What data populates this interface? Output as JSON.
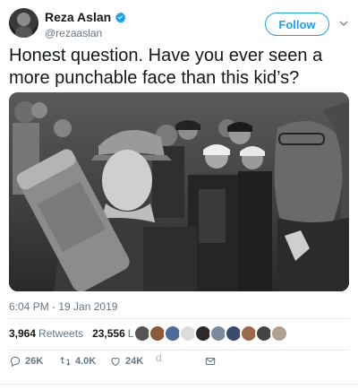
{
  "author": {
    "display_name": "Reza Aslan",
    "handle": "@rezaaslan",
    "avatar_icon": "user-avatar"
  },
  "follow_label": "Follow",
  "tweet": {
    "text": "Honest question. Have you ever seen a more punchable face than this kid’s?",
    "photo_icon": "photo-of-crowd",
    "timestamp": "6:04 PM - 19 Jan 2019"
  },
  "stats": {
    "retweets": "3,964",
    "retweets_label": "Retweets",
    "likes": "23,556",
    "likes_label": "Likes"
  },
  "actions": {
    "replies": "26K",
    "retweets": "4.0K",
    "likes": "24K",
    "stray_char": "d"
  },
  "colors": {
    "accent": "#1da1f2",
    "secondary_text": "#657786",
    "primary_text": "#14171a",
    "divider": "#e6ecf0"
  }
}
